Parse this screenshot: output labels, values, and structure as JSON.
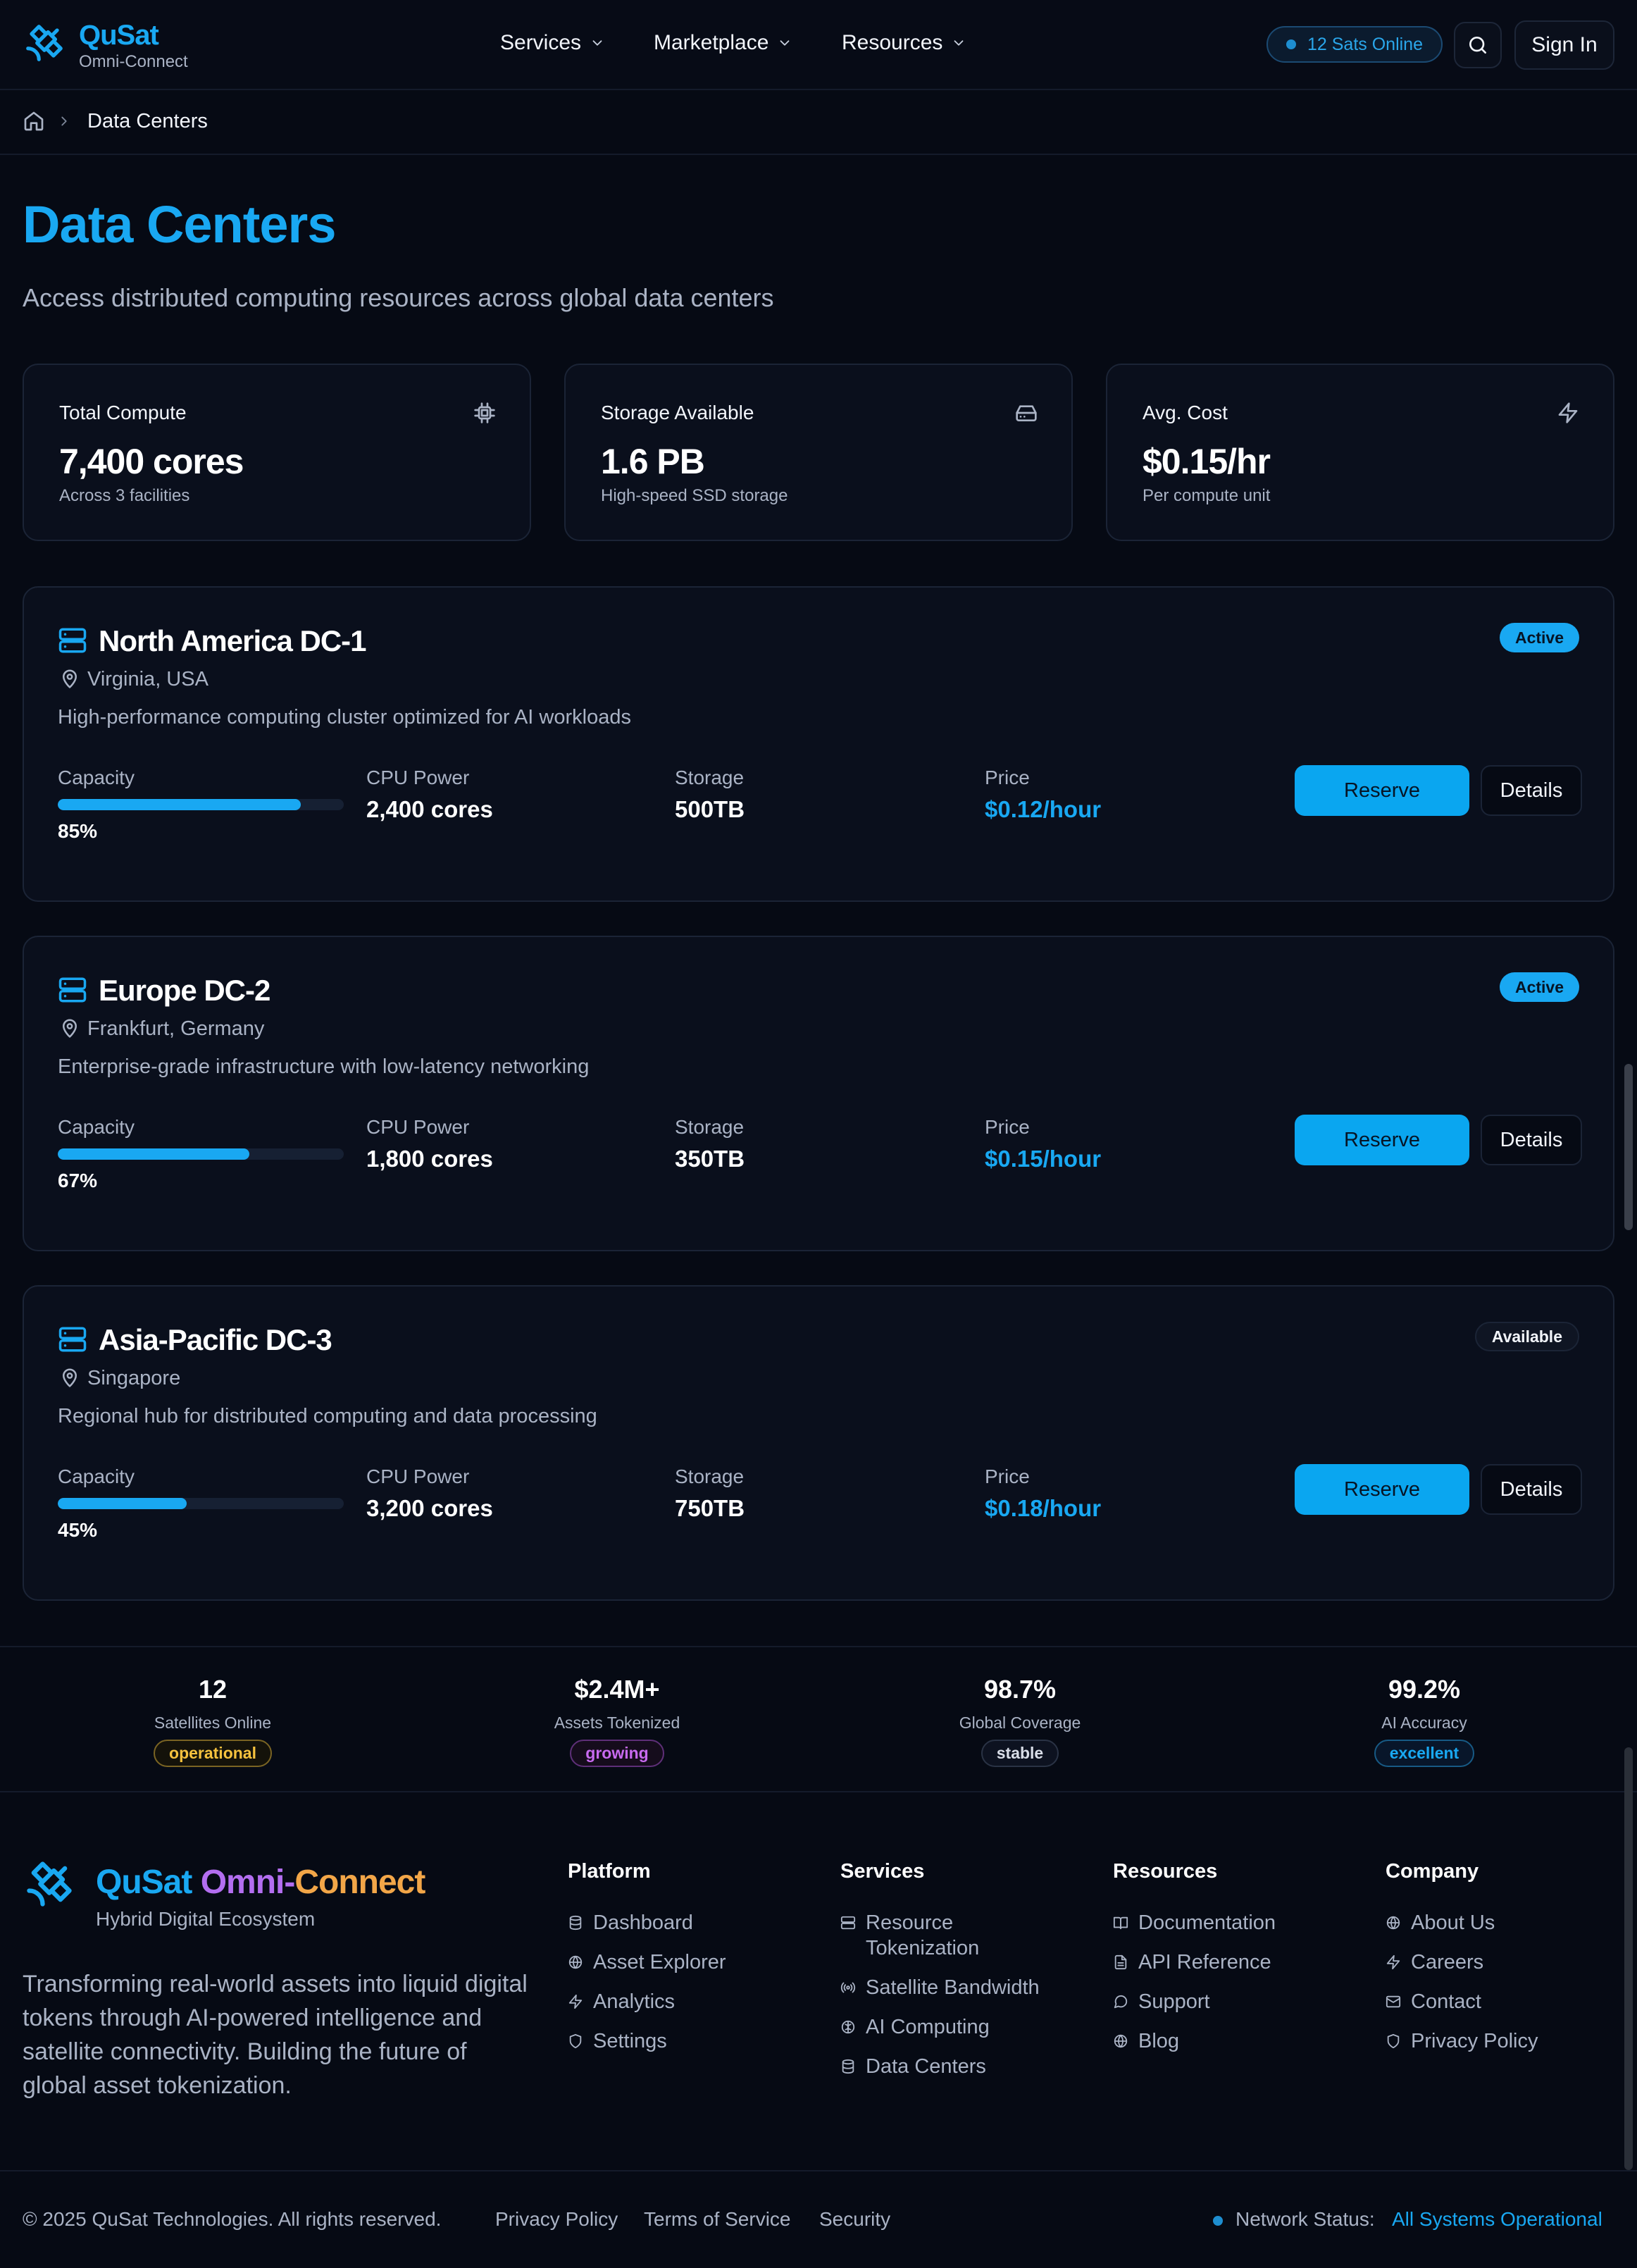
{
  "header": {
    "brand": "QuSat",
    "brand_sub": "Omni-Connect",
    "nav": [
      "Services",
      "Marketplace",
      "Resources"
    ],
    "sats_online": "12 Sats Online",
    "sign_in": "Sign In"
  },
  "breadcrumb": {
    "current": "Data Centers"
  },
  "page": {
    "title": "Data Centers",
    "subtitle": "Access distributed computing resources across global data centers"
  },
  "stats": [
    {
      "label": "Total Compute",
      "value": "7,400 cores",
      "note": "Across 3 facilities",
      "icon": "cpu-icon"
    },
    {
      "label": "Storage Available",
      "value": "1.6 PB",
      "note": "High-speed SSD storage",
      "icon": "hard-drive-icon"
    },
    {
      "label": "Avg. Cost",
      "value": "$0.15/hr",
      "note": "Per compute unit",
      "icon": "zap-icon"
    }
  ],
  "labels": {
    "capacity": "Capacity",
    "cpu": "CPU Power",
    "storage": "Storage",
    "price": "Price",
    "reserve": "Reserve",
    "details": "Details"
  },
  "datacenters": [
    {
      "name": "North America DC-1",
      "location": "Virginia, USA",
      "description": "High-performance computing cluster optimized for AI workloads",
      "status": "Active",
      "capacity": 85,
      "capacity_text": "85%",
      "cpu": "2,400 cores",
      "storage": "500TB",
      "price": "$0.12/hour"
    },
    {
      "name": "Europe DC-2",
      "location": "Frankfurt, Germany",
      "description": "Enterprise-grade infrastructure with low-latency networking",
      "status": "Active",
      "capacity": 67,
      "capacity_text": "67%",
      "cpu": "1,800 cores",
      "storage": "350TB",
      "price": "$0.15/hour"
    },
    {
      "name": "Asia-Pacific DC-3",
      "location": "Singapore",
      "description": "Regional hub for distributed computing and data processing",
      "status": "Available",
      "capacity": 45,
      "capacity_text": "45%",
      "cpu": "3,200 cores",
      "storage": "750TB",
      "price": "$0.18/hour"
    }
  ],
  "metrics": [
    {
      "value": "12",
      "label": "Satellites Online",
      "status": "operational"
    },
    {
      "value": "$2.4M+",
      "label": "Assets Tokenized",
      "status": "growing"
    },
    {
      "value": "98.7%",
      "label": "Global Coverage",
      "status": "stable"
    },
    {
      "value": "99.2%",
      "label": "AI Accuracy",
      "status": "excellent"
    }
  ],
  "footer": {
    "brand_part1": "QuSat",
    "brand_part2": "Omni-",
    "brand_part3": "Connect",
    "tagline": "Hybrid Digital Ecosystem",
    "about": "Transforming real-world assets into liquid digital tokens through AI-powered intelligence and satellite connectivity. Building the future of global asset tokenization.",
    "columns": [
      {
        "heading": "Platform",
        "items": [
          {
            "label": "Dashboard",
            "icon": "database-icon"
          },
          {
            "label": "Asset Explorer",
            "icon": "globe-icon"
          },
          {
            "label": "Analytics",
            "icon": "zap-icon"
          },
          {
            "label": "Settings",
            "icon": "shield-icon"
          }
        ]
      },
      {
        "heading": "Services",
        "items": [
          {
            "label": "Resource Tokenization",
            "icon": "server-icon"
          },
          {
            "label": "Satellite Bandwidth",
            "icon": "radio-icon"
          },
          {
            "label": "AI Computing",
            "icon": "brain-icon"
          },
          {
            "label": "Data Centers",
            "icon": "database-icon"
          }
        ]
      },
      {
        "heading": "Resources",
        "items": [
          {
            "label": "Documentation",
            "icon": "book-icon"
          },
          {
            "label": "API Reference",
            "icon": "file-icon"
          },
          {
            "label": "Support",
            "icon": "message-icon"
          },
          {
            "label": "Blog",
            "icon": "globe-icon"
          }
        ]
      },
      {
        "heading": "Company",
        "items": [
          {
            "label": "About Us",
            "icon": "globe-icon"
          },
          {
            "label": "Careers",
            "icon": "zap-icon"
          },
          {
            "label": "Contact",
            "icon": "mail-icon"
          },
          {
            "label": "Privacy Policy",
            "icon": "shield-icon"
          }
        ]
      }
    ],
    "copyright": "© 2025 QuSat Technologies. All rights reserved.",
    "links": [
      "Privacy Policy",
      "Terms of Service",
      "Security"
    ],
    "network_label": "Network Status:",
    "network_value": "All Systems Operational"
  },
  "colors": {
    "accent": "#19a8f2",
    "background": "#060a14",
    "card": "#0a0f1c"
  }
}
